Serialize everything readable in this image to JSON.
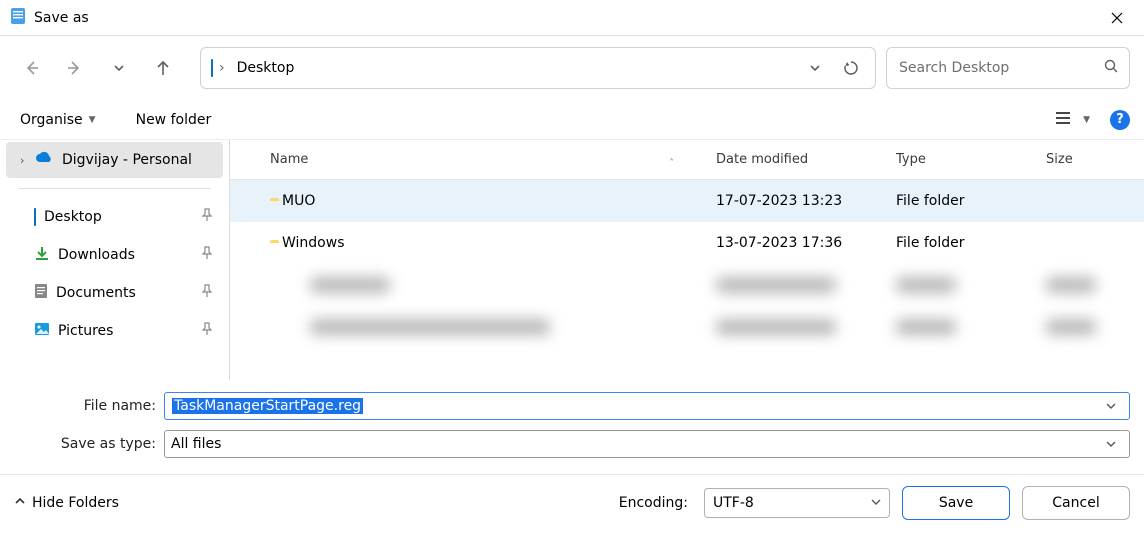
{
  "title": "Save as",
  "path": {
    "current": "Desktop"
  },
  "search": {
    "placeholder": "Search Desktop"
  },
  "toolbar": {
    "organise": "Organise",
    "new_folder": "New folder"
  },
  "tree": {
    "personal": "Digvijay - Personal",
    "desktop": "Desktop",
    "downloads": "Downloads",
    "documents": "Documents",
    "pictures": "Pictures"
  },
  "columns": {
    "name": "Name",
    "date": "Date modified",
    "type": "Type",
    "size": "Size"
  },
  "rows": [
    {
      "name": "MUO",
      "date": "17-07-2023 13:23",
      "type": "File folder"
    },
    {
      "name": "Windows",
      "date": "13-07-2023 17:36",
      "type": "File folder"
    }
  ],
  "labels": {
    "file_name": "File name:",
    "save_as_type": "Save as type:",
    "encoding": "Encoding:",
    "hide_folders": "Hide Folders"
  },
  "values": {
    "file_name": "TaskManagerStartPage.reg",
    "save_as_type": "All files",
    "encoding": "UTF-8"
  },
  "buttons": {
    "save": "Save",
    "cancel": "Cancel"
  }
}
